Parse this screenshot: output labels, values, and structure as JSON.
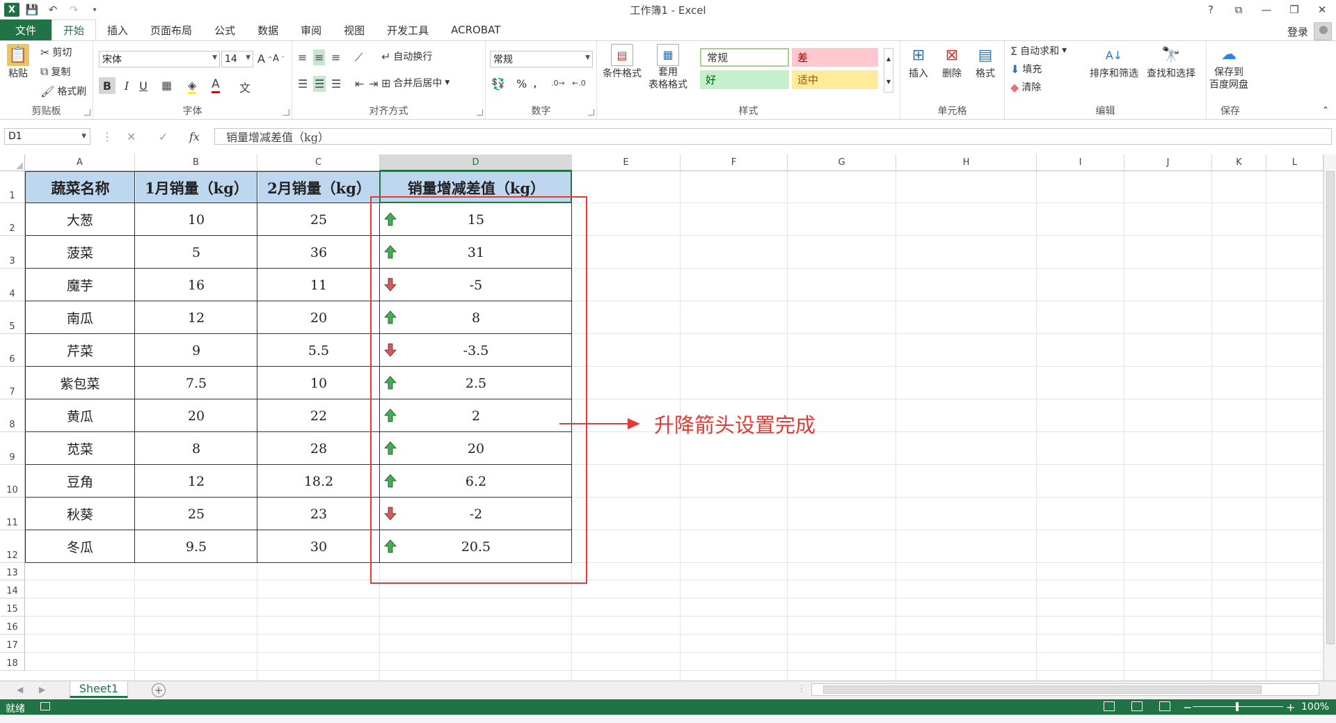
{
  "window": {
    "title": "工作簿1 - Excel",
    "controls": [
      "?",
      "⧉",
      "—",
      "❐",
      "✕"
    ]
  },
  "ribbon_tabs": {
    "file": "文件",
    "items": [
      "开始",
      "插入",
      "页面布局",
      "公式",
      "数据",
      "审阅",
      "视图",
      "开发工具",
      "ACROBAT"
    ],
    "login": "登录"
  },
  "ribbon": {
    "clipboard": {
      "paste": "粘贴",
      "cut": "剪切",
      "copy": "复制",
      "painter": "格式刷",
      "label": "剪贴板"
    },
    "font": {
      "name": "宋体",
      "size": "14",
      "bold": "B",
      "italic": "I",
      "underline": "U",
      "label": "字体"
    },
    "align": {
      "wrap": "自动换行",
      "merge": "合并后居中",
      "label": "对齐方式"
    },
    "number": {
      "format": "常规",
      "percent": "%",
      "comma": "‚",
      "label": "数字"
    },
    "styles": {
      "conditional": "条件格式",
      "table_fmt_1": "套用",
      "table_fmt_2": "表格格式",
      "normal": "常规",
      "bad": "差",
      "good": "好",
      "neutral": "适中",
      "label": "样式"
    },
    "cells": {
      "insert": "插入",
      "delete": "删除",
      "format": "格式",
      "label": "单元格"
    },
    "editing": {
      "autosum": "自动求和",
      "fill": "填充",
      "clear": "清除",
      "sort": "排序和筛选",
      "find": "查找和选择",
      "label": "编辑"
    },
    "save": {
      "line1": "保存到",
      "line2": "百度网盘",
      "label": "保存"
    }
  },
  "formula_bar": {
    "name_box": "D1",
    "fx": "fx",
    "content": "销量增减差值（kg）"
  },
  "grid": {
    "columns": [
      "A",
      "B",
      "C",
      "D",
      "E",
      "F",
      "G",
      "H",
      "I",
      "J",
      "K",
      "L"
    ],
    "rows": [
      "1",
      "2",
      "3",
      "4",
      "5",
      "6",
      "7",
      "8",
      "9",
      "10",
      "11",
      "12",
      "13",
      "14",
      "15",
      "16",
      "17",
      "18"
    ]
  },
  "table": {
    "headers": [
      "蔬菜名称",
      "1月销量（kg）",
      "2月销量（kg）",
      "销量增减差值（kg）"
    ],
    "rows": [
      {
        "name": "大葱",
        "jan": "10",
        "feb": "25",
        "diff": "15",
        "dir": "up"
      },
      {
        "name": "菠菜",
        "jan": "5",
        "feb": "36",
        "diff": "31",
        "dir": "up"
      },
      {
        "name": "魔芋",
        "jan": "16",
        "feb": "11",
        "diff": "-5",
        "dir": "down"
      },
      {
        "name": "南瓜",
        "jan": "12",
        "feb": "20",
        "diff": "8",
        "dir": "up"
      },
      {
        "name": "芹菜",
        "jan": "9",
        "feb": "5.5",
        "diff": "-3.5",
        "dir": "down"
      },
      {
        "name": "紫包菜",
        "jan": "7.5",
        "feb": "10",
        "diff": "2.5",
        "dir": "up"
      },
      {
        "name": "黄瓜",
        "jan": "20",
        "feb": "22",
        "diff": "2",
        "dir": "up"
      },
      {
        "name": "苋菜",
        "jan": "8",
        "feb": "28",
        "diff": "20",
        "dir": "up"
      },
      {
        "name": "豆角",
        "jan": "12",
        "feb": "18.2",
        "diff": "6.2",
        "dir": "up"
      },
      {
        "name": "秋葵",
        "jan": "25",
        "feb": "23",
        "diff": "-2",
        "dir": "down"
      },
      {
        "name": "冬瓜",
        "jan": "9.5",
        "feb": "30",
        "diff": "20.5",
        "dir": "up"
      }
    ]
  },
  "annotation": {
    "text": "升降箭头设置完成",
    "color": "#e53935"
  },
  "colors": {
    "excel_green": "#217346",
    "header_fill": "#bdd7ee",
    "arrow_up": "#3cb44b",
    "arrow_down": "#e05555"
  },
  "sheets": {
    "active": "Sheet1",
    "add": "+"
  },
  "status": {
    "ready": "就绪",
    "zoom": "100%",
    "minus": "−",
    "plus": "+"
  }
}
